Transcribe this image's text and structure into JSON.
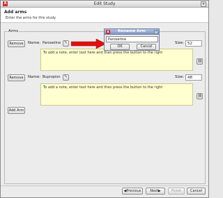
{
  "window": {
    "title": "Edit Study",
    "app_icon_glyph": "A",
    "close_glyph": "✕"
  },
  "header": {
    "title": "Add arms",
    "subtitle": "Enter the arms for this study."
  },
  "arms_section": {
    "legend": "Arms",
    "name_label": "Name:",
    "size_label": "Size:",
    "remove_label": "Remove",
    "edit_icon": "pencil-icon",
    "delete_icon": "trash-icon",
    "arms": [
      {
        "name": "Paroxetine",
        "size": "52",
        "note_placeholder": "To add a note, enter text here and then press the button to the right"
      },
      {
        "name": "Bupropion",
        "size": "48",
        "note_placeholder": "To add a note, enter text here and then press the button to the right"
      }
    ],
    "add_arm_label": "Add Arm"
  },
  "rename_dialog": {
    "title": "Rename Arm",
    "value": "Paroxetine",
    "ok_label": "OK",
    "cancel_label": "Cancel"
  },
  "footer": {
    "previous_label": "Previous",
    "next_label": "Next",
    "finish_label": "Finish",
    "cancel_label": "Cancel"
  },
  "colors": {
    "arrow": "#e01010",
    "note_bg": "#ffffd0",
    "dialog_title": "#7f96c4"
  }
}
